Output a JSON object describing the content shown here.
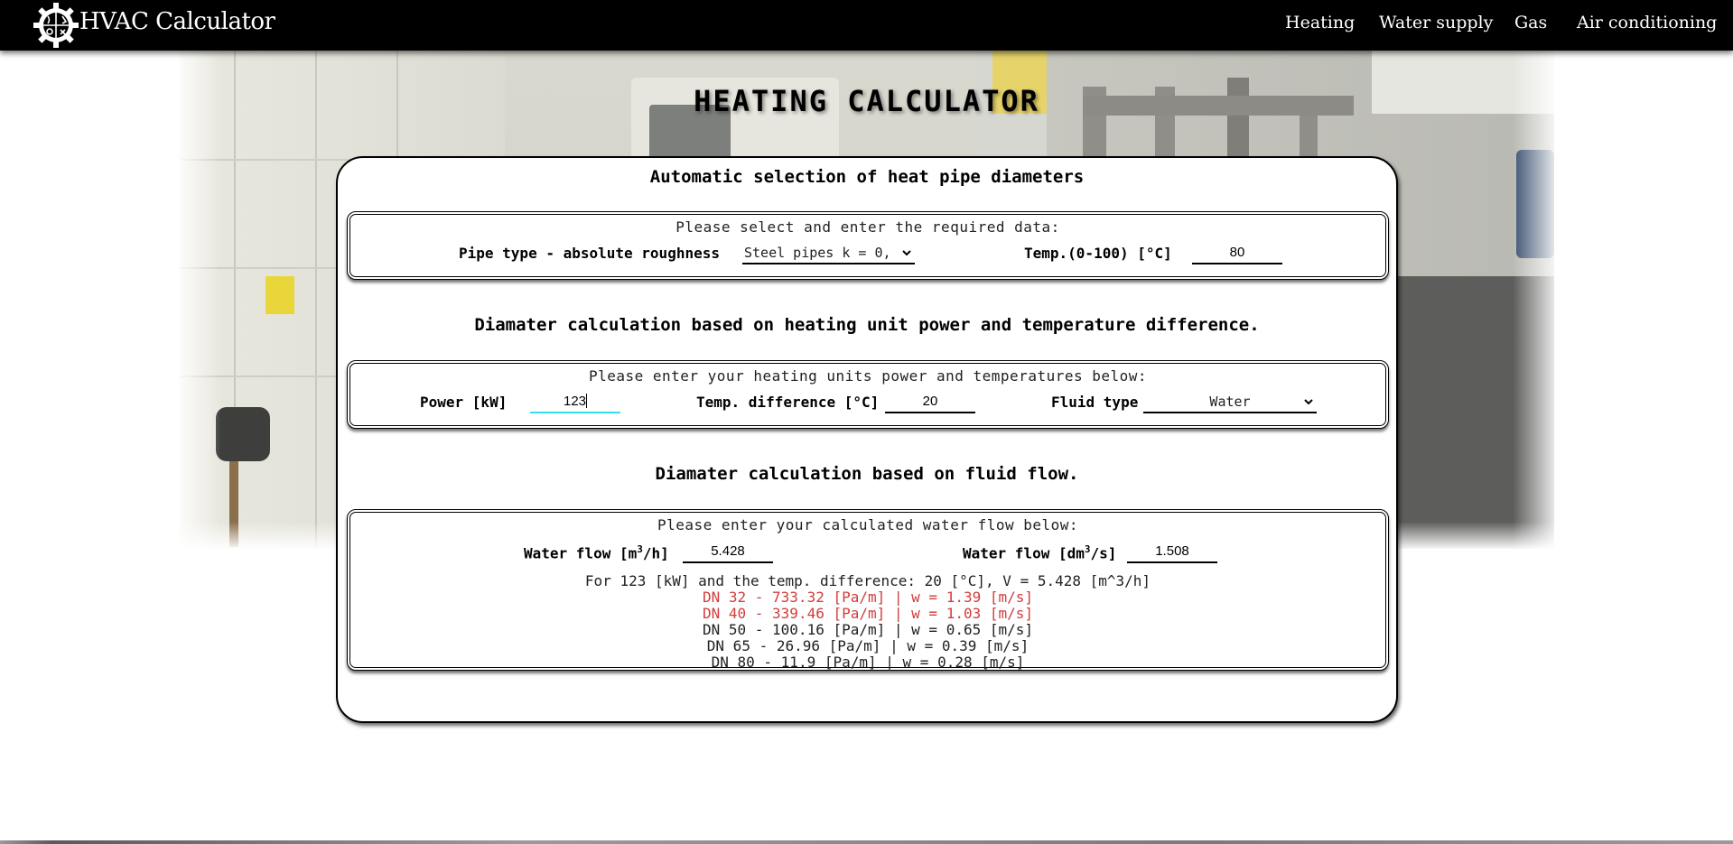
{
  "app": {
    "brand": "HVAC Calculator",
    "logo_icon": "gear-logo-icon"
  },
  "nav": {
    "items": [
      "Heating",
      "Water supply",
      "Gas",
      "Air conditioning"
    ]
  },
  "page": {
    "title": "HEATING CALCULATOR"
  },
  "card": {
    "title": "Automatic selection of heat pipe diameters",
    "pipe_section": {
      "caption": "Please select and enter the required data:",
      "pipe_type_label": "Pipe type - absolute roughness",
      "pipe_type_value": "Steel pipes k = 0,",
      "temp_label": "Temp.(0-100) [°C]",
      "temp_value": "80"
    },
    "power_title": "Diamater calculation based on heating unit power and temperature difference.",
    "power_section": {
      "caption": "Please enter your heating units power and temperatures below:",
      "power_label": "Power [kW]",
      "power_value": "123",
      "temp_diff_label": "Temp. difference [°C]",
      "temp_diff_value": "20",
      "fluid_label": "Fluid type",
      "fluid_value": "Water"
    },
    "flow_title": "Diamater calculation based on fluid flow.",
    "flow_section": {
      "caption": "Please enter your calculated water flow below:",
      "flow_m3h_label_prefix": "Water flow [m",
      "flow_m3h_label_sup": "3",
      "flow_m3h_label_suffix": "/h]",
      "flow_m3h_value": "5.428",
      "flow_dm3s_label_prefix": "Water flow [dm",
      "flow_dm3s_label_sup": "3",
      "flow_dm3s_label_suffix": "/s]",
      "flow_dm3s_value": "1.508",
      "summary": "For 123 [kW] and the temp. difference: 20 [°C], V = 5.428 [m^3/h]",
      "rows": [
        {
          "text": "DN 32 - 733.32 [Pa/m] | w = 1.39 [m/s]",
          "status": "warning"
        },
        {
          "text": "DN 40 - 339.46 [Pa/m] | w = 1.03 [m/s]",
          "status": "warning"
        },
        {
          "text": "DN 50 - 100.16 [Pa/m] | w = 0.65 [m/s]",
          "status": "ok"
        },
        {
          "text": "DN 65 - 26.96 [Pa/m] | w = 0.39 [m/s]",
          "status": "ok"
        },
        {
          "text": "DN 80 - 11.9 [Pa/m] | w = 0.28 [m/s]",
          "status": "ok"
        }
      ]
    }
  },
  "colors": {
    "navbar": "#000000",
    "warning_text": "#d23c3c",
    "ok_text": "#222222",
    "focus_underline": "#2ee0ee"
  }
}
